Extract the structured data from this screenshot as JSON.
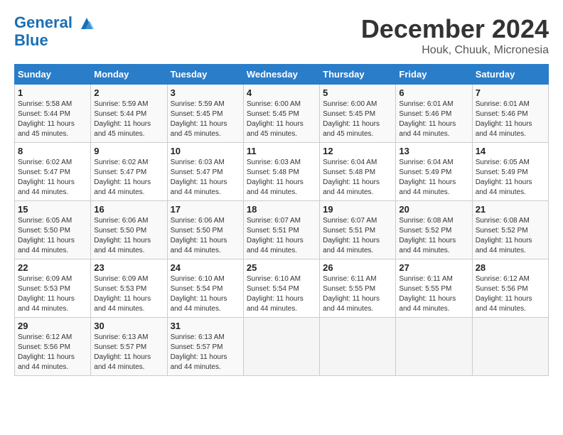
{
  "header": {
    "logo_line1": "General",
    "logo_line2": "Blue",
    "month_title": "December 2024",
    "location": "Houk, Chuuk, Micronesia"
  },
  "calendar": {
    "columns": [
      "Sunday",
      "Monday",
      "Tuesday",
      "Wednesday",
      "Thursday",
      "Friday",
      "Saturday"
    ],
    "weeks": [
      [
        {
          "day": "1",
          "info": "Sunrise: 5:58 AM\nSunset: 5:44 PM\nDaylight: 11 hours and 45 minutes."
        },
        {
          "day": "2",
          "info": "Sunrise: 5:59 AM\nSunset: 5:44 PM\nDaylight: 11 hours and 45 minutes."
        },
        {
          "day": "3",
          "info": "Sunrise: 5:59 AM\nSunset: 5:45 PM\nDaylight: 11 hours and 45 minutes."
        },
        {
          "day": "4",
          "info": "Sunrise: 6:00 AM\nSunset: 5:45 PM\nDaylight: 11 hours and 45 minutes."
        },
        {
          "day": "5",
          "info": "Sunrise: 6:00 AM\nSunset: 5:45 PM\nDaylight: 11 hours and 45 minutes."
        },
        {
          "day": "6",
          "info": "Sunrise: 6:01 AM\nSunset: 5:46 PM\nDaylight: 11 hours and 44 minutes."
        },
        {
          "day": "7",
          "info": "Sunrise: 6:01 AM\nSunset: 5:46 PM\nDaylight: 11 hours and 44 minutes."
        }
      ],
      [
        {
          "day": "8",
          "info": "Sunrise: 6:02 AM\nSunset: 5:47 PM\nDaylight: 11 hours and 44 minutes."
        },
        {
          "day": "9",
          "info": "Sunrise: 6:02 AM\nSunset: 5:47 PM\nDaylight: 11 hours and 44 minutes."
        },
        {
          "day": "10",
          "info": "Sunrise: 6:03 AM\nSunset: 5:47 PM\nDaylight: 11 hours and 44 minutes."
        },
        {
          "day": "11",
          "info": "Sunrise: 6:03 AM\nSunset: 5:48 PM\nDaylight: 11 hours and 44 minutes."
        },
        {
          "day": "12",
          "info": "Sunrise: 6:04 AM\nSunset: 5:48 PM\nDaylight: 11 hours and 44 minutes."
        },
        {
          "day": "13",
          "info": "Sunrise: 6:04 AM\nSunset: 5:49 PM\nDaylight: 11 hours and 44 minutes."
        },
        {
          "day": "14",
          "info": "Sunrise: 6:05 AM\nSunset: 5:49 PM\nDaylight: 11 hours and 44 minutes."
        }
      ],
      [
        {
          "day": "15",
          "info": "Sunrise: 6:05 AM\nSunset: 5:50 PM\nDaylight: 11 hours and 44 minutes."
        },
        {
          "day": "16",
          "info": "Sunrise: 6:06 AM\nSunset: 5:50 PM\nDaylight: 11 hours and 44 minutes."
        },
        {
          "day": "17",
          "info": "Sunrise: 6:06 AM\nSunset: 5:50 PM\nDaylight: 11 hours and 44 minutes."
        },
        {
          "day": "18",
          "info": "Sunrise: 6:07 AM\nSunset: 5:51 PM\nDaylight: 11 hours and 44 minutes."
        },
        {
          "day": "19",
          "info": "Sunrise: 6:07 AM\nSunset: 5:51 PM\nDaylight: 11 hours and 44 minutes."
        },
        {
          "day": "20",
          "info": "Sunrise: 6:08 AM\nSunset: 5:52 PM\nDaylight: 11 hours and 44 minutes."
        },
        {
          "day": "21",
          "info": "Sunrise: 6:08 AM\nSunset: 5:52 PM\nDaylight: 11 hours and 44 minutes."
        }
      ],
      [
        {
          "day": "22",
          "info": "Sunrise: 6:09 AM\nSunset: 5:53 PM\nDaylight: 11 hours and 44 minutes."
        },
        {
          "day": "23",
          "info": "Sunrise: 6:09 AM\nSunset: 5:53 PM\nDaylight: 11 hours and 44 minutes."
        },
        {
          "day": "24",
          "info": "Sunrise: 6:10 AM\nSunset: 5:54 PM\nDaylight: 11 hours and 44 minutes."
        },
        {
          "day": "25",
          "info": "Sunrise: 6:10 AM\nSunset: 5:54 PM\nDaylight: 11 hours and 44 minutes."
        },
        {
          "day": "26",
          "info": "Sunrise: 6:11 AM\nSunset: 5:55 PM\nDaylight: 11 hours and 44 minutes."
        },
        {
          "day": "27",
          "info": "Sunrise: 6:11 AM\nSunset: 5:55 PM\nDaylight: 11 hours and 44 minutes."
        },
        {
          "day": "28",
          "info": "Sunrise: 6:12 AM\nSunset: 5:56 PM\nDaylight: 11 hours and 44 minutes."
        }
      ],
      [
        {
          "day": "29",
          "info": "Sunrise: 6:12 AM\nSunset: 5:56 PM\nDaylight: 11 hours and 44 minutes."
        },
        {
          "day": "30",
          "info": "Sunrise: 6:13 AM\nSunset: 5:57 PM\nDaylight: 11 hours and 44 minutes."
        },
        {
          "day": "31",
          "info": "Sunrise: 6:13 AM\nSunset: 5:57 PM\nDaylight: 11 hours and 44 minutes."
        },
        {
          "day": "",
          "info": ""
        },
        {
          "day": "",
          "info": ""
        },
        {
          "day": "",
          "info": ""
        },
        {
          "day": "",
          "info": ""
        }
      ]
    ]
  }
}
